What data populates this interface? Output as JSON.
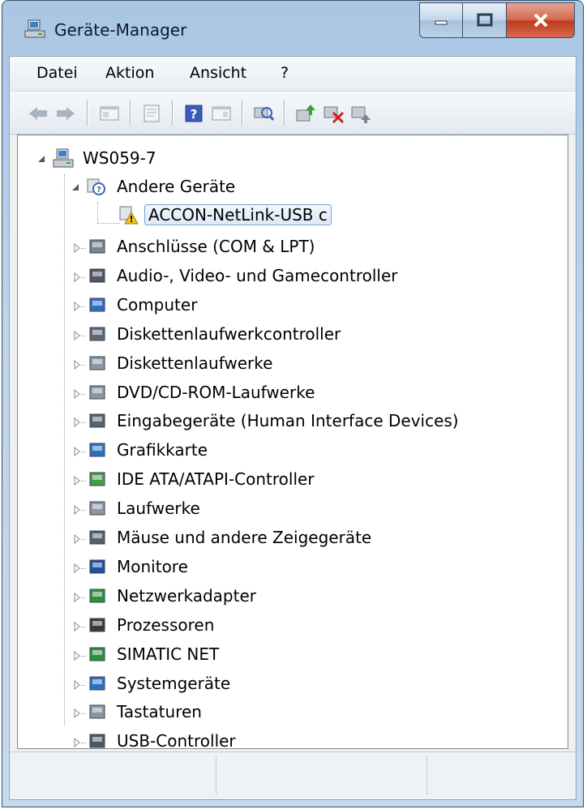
{
  "window": {
    "title": "Geräte-Manager"
  },
  "menu": [
    "Datei",
    "Aktion",
    "Ansicht",
    "?"
  ],
  "toolbar": [
    "back-icon",
    "forward-icon",
    "show-hide-tree-icon",
    "properties-icon",
    "help-icon",
    "view-icon",
    "scan-hardware-icon",
    "update-driver-icon",
    "disable-device-icon",
    "uninstall-device-icon"
  ],
  "tree": {
    "root": "WS059-7",
    "other_devices": "Andere Geräte",
    "selected_device": "ACCON-NetLink-USB c",
    "categories": [
      "Anschlüsse (COM & LPT)",
      "Audio-, Video- und Gamecontroller",
      "Computer",
      "Diskettenlaufwerkcontroller",
      "Diskettenlaufwerke",
      "DVD/CD-ROM-Laufwerke",
      "Eingabegeräte (Human Interface Devices)",
      "Grafikkarte",
      "IDE ATA/ATAPI-Controller",
      "Laufwerke",
      "Mäuse und andere Zeigegeräte",
      "Monitore",
      "Netzwerkadapter",
      "Prozessoren",
      "SIMATIC NET",
      "Systemgeräte",
      "Tastaturen",
      "USB-Controller"
    ]
  },
  "status": [
    "",
    "",
    ""
  ]
}
